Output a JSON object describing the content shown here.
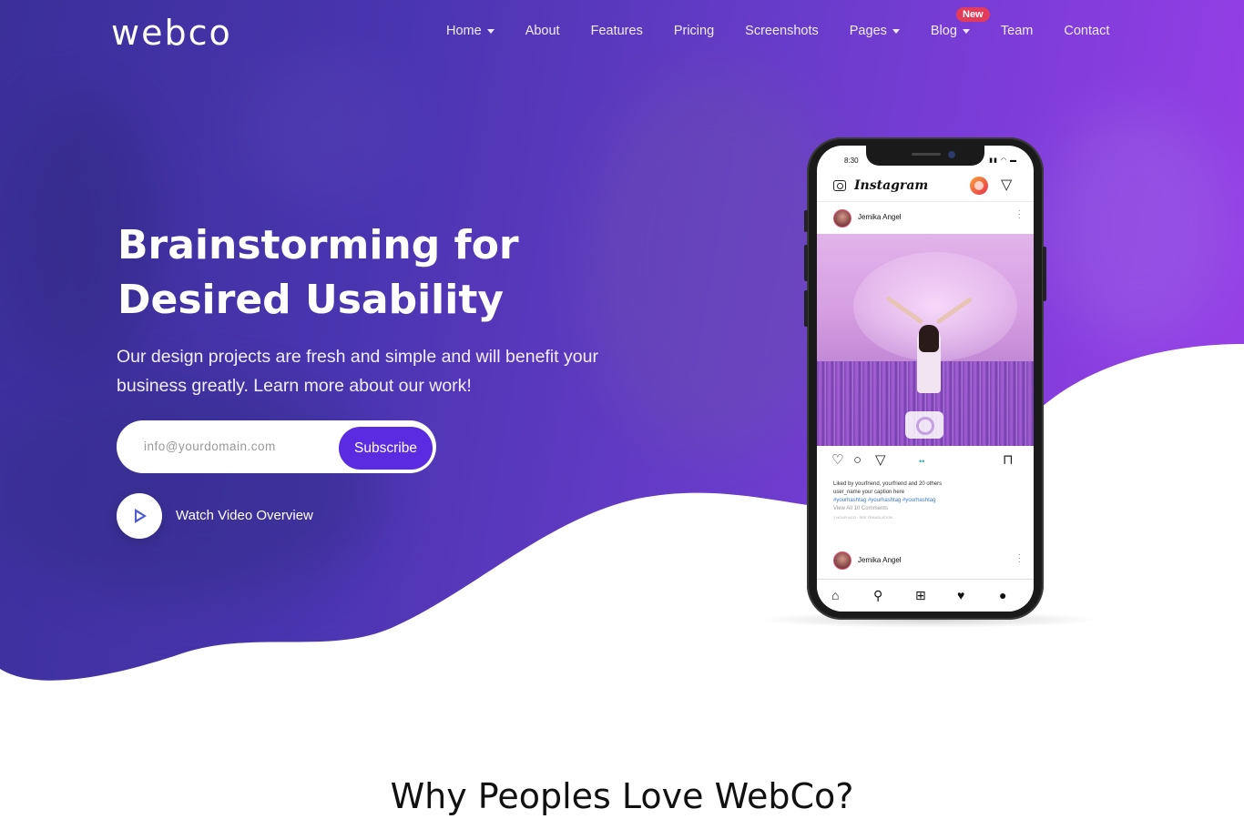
{
  "brand": {
    "logo": "webco"
  },
  "nav": {
    "items": [
      {
        "label": "Home",
        "dropdown": true
      },
      {
        "label": "About",
        "dropdown": false
      },
      {
        "label": "Features",
        "dropdown": false
      },
      {
        "label": "Pricing",
        "dropdown": false
      },
      {
        "label": "Screenshots",
        "dropdown": false
      },
      {
        "label": "Pages",
        "dropdown": true
      },
      {
        "label": "Blog",
        "dropdown": true
      },
      {
        "label": "Team",
        "dropdown": false
      },
      {
        "label": "Contact",
        "dropdown": false
      }
    ],
    "blog_badge": "New"
  },
  "hero": {
    "headline_line1": "Brainstorming for",
    "headline_line2": "Desired Usability",
    "subtext": "Our design projects are fresh and simple and will benefit your business greatly. Learn more about our work!",
    "email_placeholder": "info@yourdomain.com",
    "subscribe_label": "Subscribe",
    "video_label": "Watch Video Overview"
  },
  "phone": {
    "status_time": "8:30",
    "app_title": "Instagram",
    "post_user": "Jemika Angel",
    "likes_text": "Liked by yourfriend, yourfriend and 20 others",
    "caption": "user_name your caption here",
    "hashtags": "#yourhashtag #yourhashtag #yourhashtag",
    "comments": "View All 10 Comments",
    "translation": "1 HOUR AGO · SEE TRANSLATION",
    "post_user_2": "Jemika Angel"
  },
  "section": {
    "title": "Why Peoples Love WebCo?"
  },
  "colors": {
    "hero_gradient_start": "#3b2f9a",
    "hero_gradient_end": "#9a40e8",
    "subscribe_button": "#5a2be0",
    "badge": "#e23c5a",
    "play_icon": "#4d5cd6"
  }
}
